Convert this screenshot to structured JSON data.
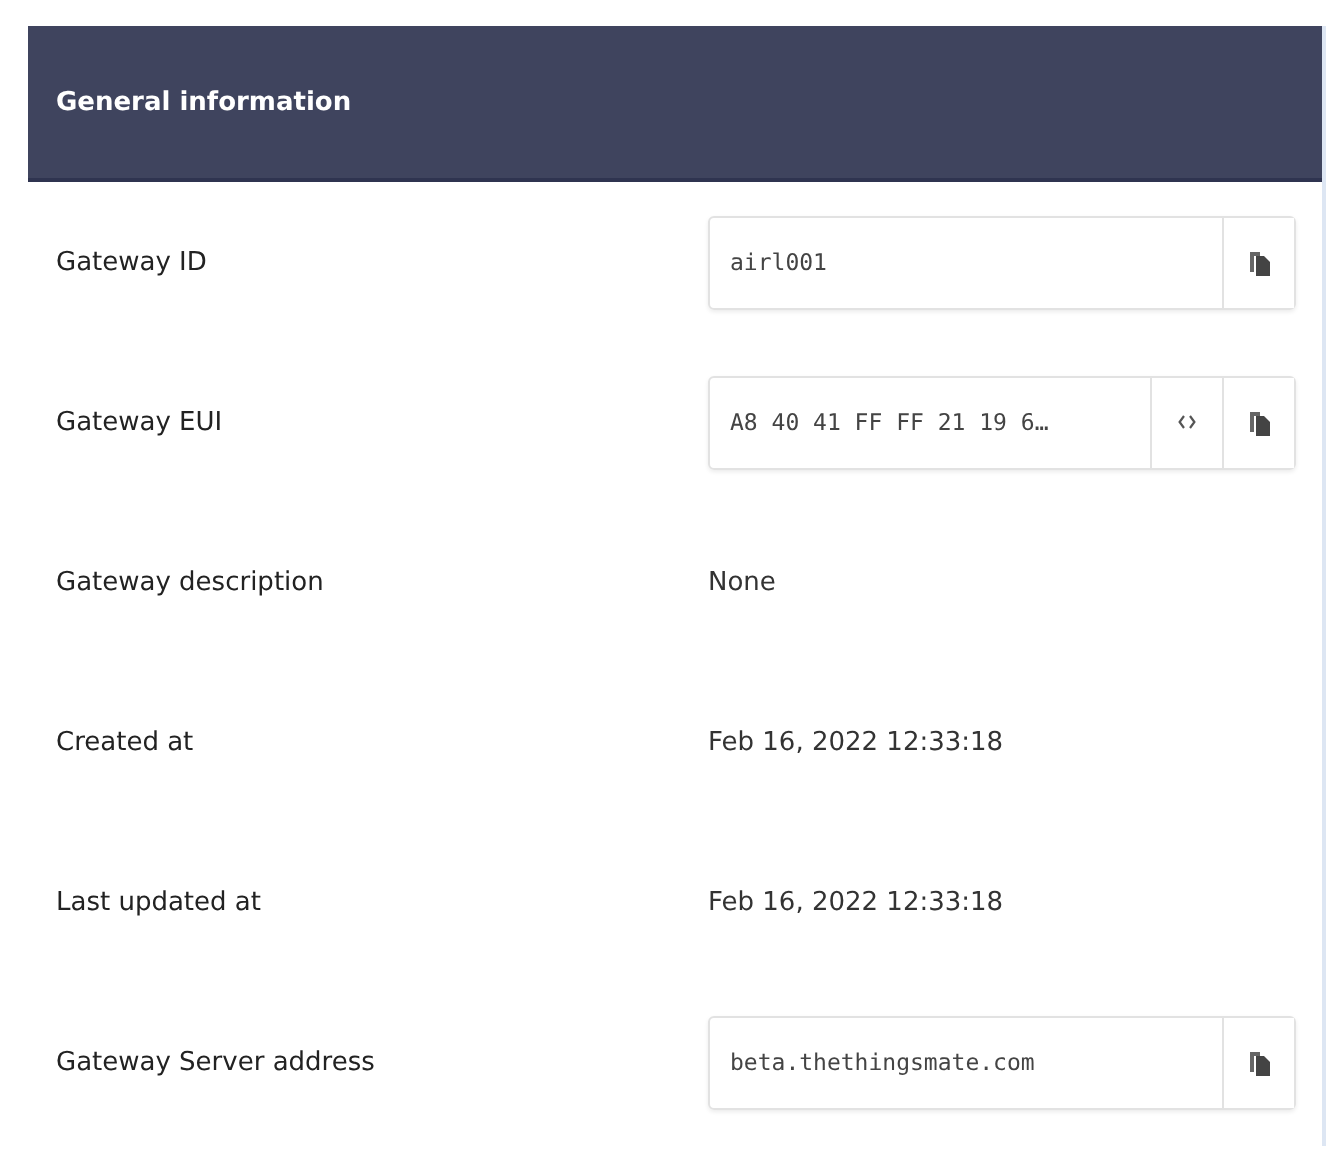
{
  "panel": {
    "title": "General information"
  },
  "rows": [
    {
      "label": "Gateway ID",
      "kind": "field",
      "value": "airl001",
      "format_toggle": false
    },
    {
      "label": "Gateway EUI",
      "kind": "field",
      "value": "A8 40 41 FF FF 21 19 6…",
      "format_toggle": true
    },
    {
      "label": "Gateway description",
      "kind": "text",
      "value": "None"
    },
    {
      "label": "Created at",
      "kind": "text",
      "value": "Feb 16, 2022 12:33:18"
    },
    {
      "label": "Last updated at",
      "kind": "text",
      "value": "Feb 16, 2022 12:33:18"
    },
    {
      "label": "Gateway Server address",
      "kind": "field",
      "value": "beta.thethingsmate.com",
      "format_toggle": false
    }
  ]
}
